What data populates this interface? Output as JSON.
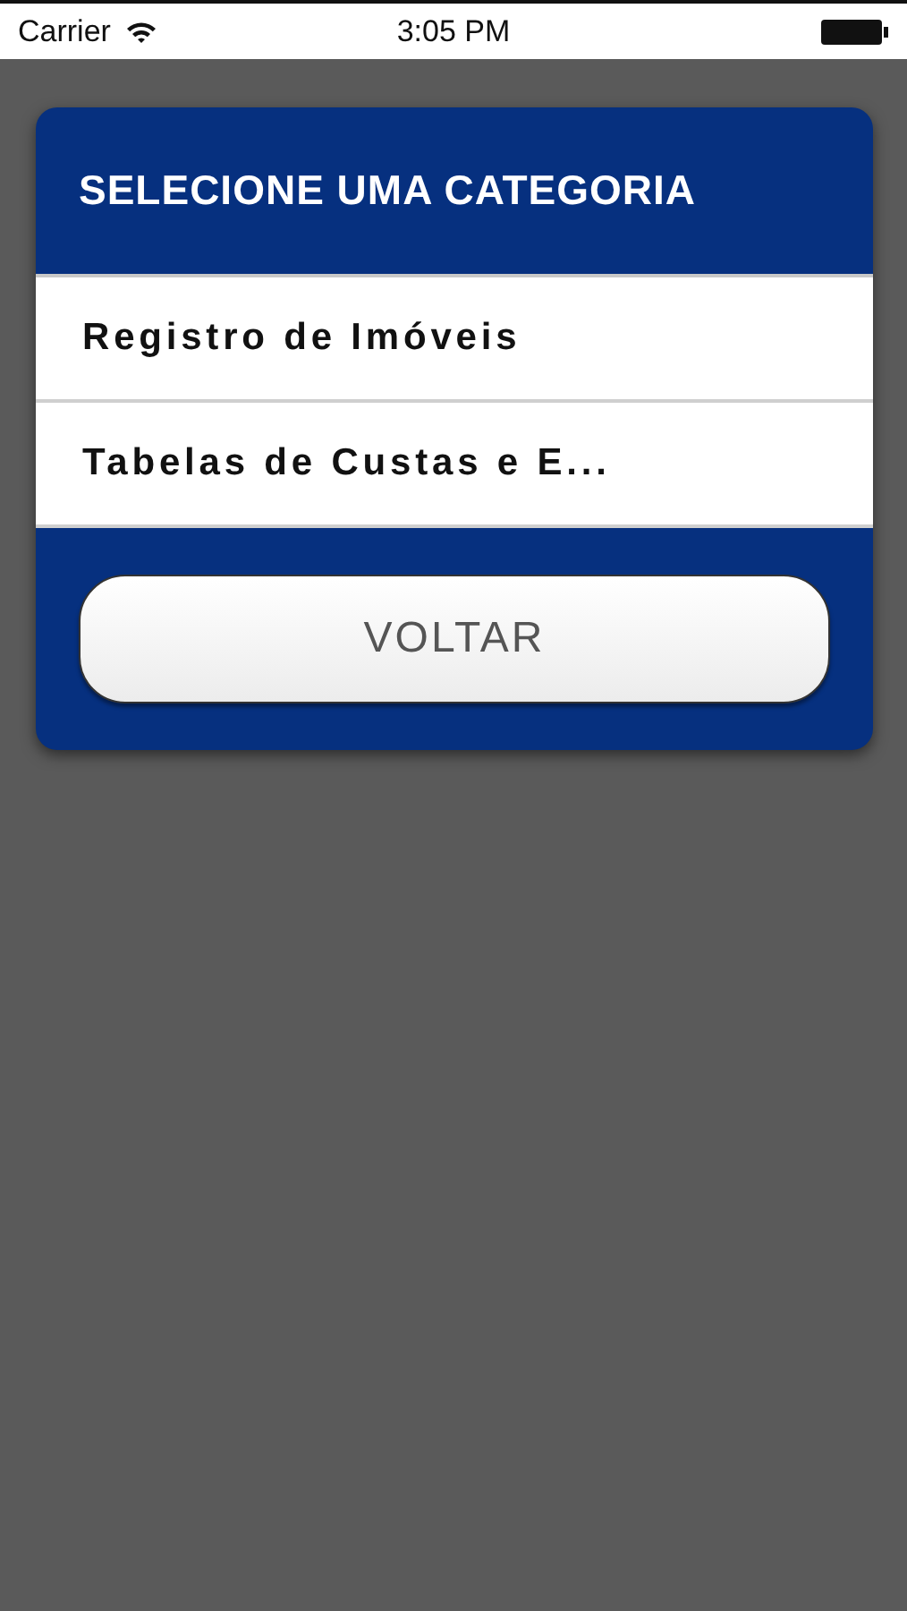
{
  "status_bar": {
    "carrier": "Carrier",
    "time": "3:05 PM"
  },
  "dialog": {
    "title": "SELECIONE UMA CATEGORIA",
    "items": [
      {
        "label": "Registro de Imóveis",
        "selected": false
      },
      {
        "label": "Tabelas de Custas e E...",
        "selected": false
      }
    ],
    "button": "VOLTAR"
  }
}
